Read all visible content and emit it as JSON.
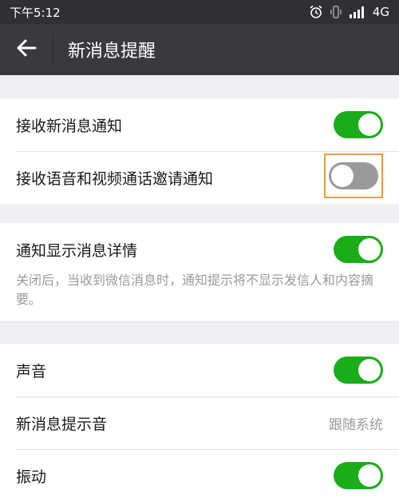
{
  "status_bar": {
    "time": "下午5:12",
    "network": "4G",
    "icons": [
      "alarm-icon",
      "vibrate-icon",
      "signal-icon"
    ]
  },
  "header": {
    "back_icon": "arrow-left-icon",
    "title": "新消息提醒"
  },
  "groups": [
    {
      "items": [
        {
          "label": "接收新消息通知",
          "toggle": true
        },
        {
          "label": "接收语音和视频通话邀请通知",
          "toggle": false
        }
      ]
    },
    {
      "items": [
        {
          "label": "通知显示消息详情",
          "toggle": true
        }
      ],
      "hint": "关闭后，当收到微信消息时，通知提示将不显示发信人和内容摘要。"
    },
    {
      "items": [
        {
          "label": "声音",
          "toggle": true
        },
        {
          "label": "新消息提示音",
          "value": "跟随系统"
        },
        {
          "label": "振动",
          "toggle": true
        }
      ]
    }
  ],
  "colors": {
    "toggle_on": "#1aad19",
    "toggle_off": "#9a9a9a",
    "highlight_border": "#f39a3a",
    "app_bar": "#393a3f"
  }
}
